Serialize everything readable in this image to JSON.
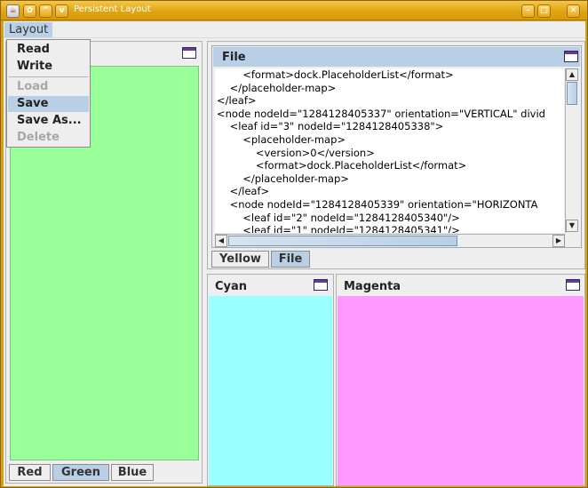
{
  "window": {
    "title": "Persistent Layout",
    "frame_color": "#d89a0a",
    "icons": [
      "java-icon",
      "window-menu-icon",
      "shade-up-icon",
      "shade-down-icon",
      "minimize-icon",
      "maximize-icon",
      "close-icon"
    ]
  },
  "menubar": {
    "layout_label": "Layout"
  },
  "menu": {
    "items": [
      "Read",
      "Write",
      "Load",
      "Save",
      "Save As...",
      "Delete"
    ],
    "disabled": [
      "Load",
      "Delete"
    ],
    "hovered": "Save"
  },
  "left": {
    "tabs": [
      "Red",
      "Green",
      "Blue"
    ],
    "active_tab": "Green",
    "content_color": "#99ff99"
  },
  "file_panel": {
    "title": "File",
    "lines": [
      "        <format>dock.PlaceholderList</format>",
      "    </placeholder-map>",
      "</leaf>",
      "<node nodeId=\"1284128405337\" orientation=\"VERTICAL\" divid",
      "    <leaf id=\"3\" nodeId=\"1284128405338\">",
      "        <placeholder-map>",
      "            <version>0</version>",
      "            <format>dock.PlaceholderList</format>",
      "        </placeholder-map>",
      "    </leaf>",
      "    <node nodeId=\"1284128405339\" orientation=\"HORIZONTA",
      "        <leaf id=\"2\" nodeId=\"1284128405340\"/>",
      "        <leaf id=\"1\" nodeId=\"1284128405341\"/>"
    ],
    "tabs": [
      "Yellow",
      "File"
    ],
    "active_tab": "File"
  },
  "cyan": {
    "title": "Cyan",
    "content_color": "#99ffff"
  },
  "magenta": {
    "title": "Magenta",
    "content_color": "#ff99ff"
  }
}
